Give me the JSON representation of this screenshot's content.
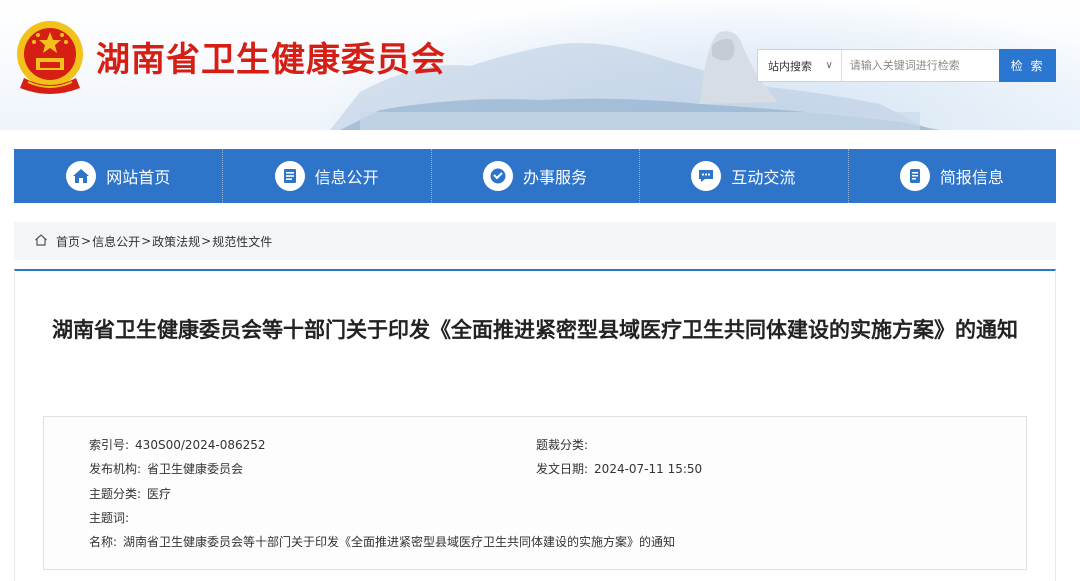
{
  "header": {
    "site_title": "湖南省卫生健康委员会",
    "emblem_icon": "national-emblem-icon",
    "title_color": "#d51e14"
  },
  "search": {
    "scope_label": "站内搜索",
    "placeholder": "请输入关键词进行检索",
    "button_label": "检 索"
  },
  "nav": {
    "accent": "#2e74c9",
    "items": [
      {
        "label": "网站首页",
        "icon": "home-icon"
      },
      {
        "label": "信息公开",
        "icon": "document-list-icon"
      },
      {
        "label": "办事服务",
        "icon": "service-icon"
      },
      {
        "label": "互动交流",
        "icon": "chat-icon"
      },
      {
        "label": "简报信息",
        "icon": "bulletin-icon"
      }
    ]
  },
  "breadcrumb": {
    "items": [
      "首页",
      "信息公开",
      "政策法规",
      "规范性文件"
    ],
    "separator": ">"
  },
  "article": {
    "title": "湖南省卫生健康委员会等十部门关于印发《全面推进紧密型县域医疗卫生共同体建设的实施方案》的通知",
    "meta": {
      "index_label": "索引号:",
      "index_value": "430S00/2024-086252",
      "genre_label": "题裁分类:",
      "genre_value": "",
      "publisher_label": "发布机构:",
      "publisher_value": "省卫生健康委员会",
      "date_label": "发文日期:",
      "date_value": "2024-07-11 15:50",
      "topic_label": "主题分类:",
      "topic_value": "医疗",
      "keywords_label": "主题词:",
      "keywords_value": "",
      "name_label": "名称:",
      "name_value": "湖南省卫生健康委员会等十部门关于印发《全面推进紧密型县域医疗卫生共同体建设的实施方案》的通知"
    }
  }
}
